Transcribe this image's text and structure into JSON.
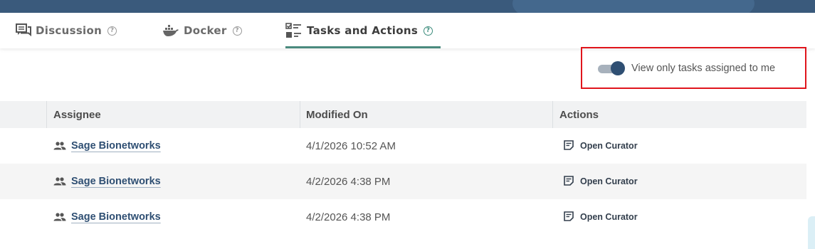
{
  "tabs": [
    {
      "label": "Discussion",
      "icon": "discussion-icon",
      "help": "?"
    },
    {
      "label": "Docker",
      "icon": "docker-icon",
      "help": "?"
    },
    {
      "label": "Tasks and Actions",
      "icon": "tasks-icon",
      "help": "?",
      "active": true
    }
  ],
  "filter": {
    "toggle_label": "View only tasks assigned to me",
    "toggle_on": true
  },
  "table": {
    "columns": [
      "Assignee",
      "Modified On",
      "Actions"
    ],
    "rows": [
      {
        "assignee": "Sage Bionetworks",
        "modified": "4/1/2026 10:52 AM",
        "action": "Open Curator"
      },
      {
        "assignee": "Sage Bionetworks",
        "modified": "4/2/2026 4:38 PM",
        "action": "Open Curator"
      },
      {
        "assignee": "Sage Bionetworks",
        "modified": "4/2/2026 4:38 PM",
        "action": "Open Curator"
      }
    ]
  },
  "colors": {
    "accent": "#2f4f73",
    "tab_underline": "#4a8a7e",
    "highlight_border": "#e0151c"
  }
}
